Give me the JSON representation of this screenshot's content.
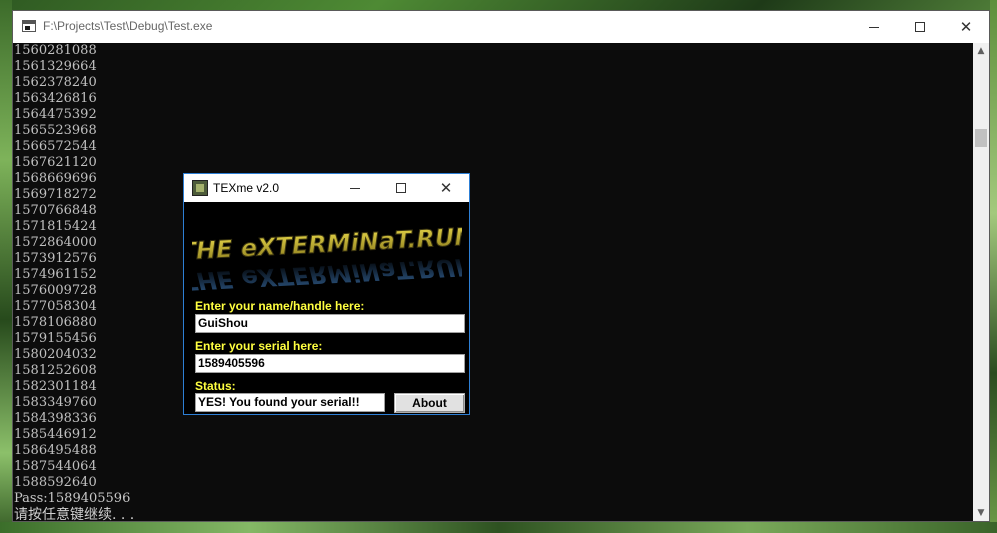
{
  "console": {
    "title": "F:\\Projects\\Test\\Debug\\Test.exe",
    "lines": [
      "1560281088",
      "1561329664",
      "1562378240",
      "1563426816",
      "1564475392",
      "1565523968",
      "1566572544",
      "1567621120",
      "1568669696",
      "1569718272",
      "1570766848",
      "1571815424",
      "1572864000",
      "1573912576",
      "1574961152",
      "1576009728",
      "1577058304",
      "1578106880",
      "1579155456",
      "1580204032",
      "1581252608",
      "1582301184",
      "1583349760",
      "1584398336",
      "1585446912",
      "1586495488",
      "1587544064",
      "1588592640"
    ],
    "pass_line": "Pass:1589405596",
    "prompt_line": "请按任意键继续. . ."
  },
  "dialog": {
    "title": "TEXme v2.0",
    "logo_text": "THE eXTERMiNaT.RUN",
    "name_label": "Enter your name/handle here:",
    "name_value": "GuiShou",
    "serial_label": "Enter your serial here:",
    "serial_value": "1589405596",
    "status_label": "Status:",
    "status_value": "YES! You found your serial!!",
    "about_label": "About"
  },
  "icons": {
    "minimize": "minimize-icon",
    "maximize": "maximize-icon",
    "close": "close-icon",
    "scroll_up": "chevron-up-icon",
    "scroll_down": "chevron-down-icon"
  },
  "colors": {
    "console_bg": "#0c0c0c",
    "console_text": "#c0c0c0",
    "dialog_bg": "#000000",
    "label_yellow": "#ffff40",
    "dialog_border": "#2d7fd5"
  }
}
